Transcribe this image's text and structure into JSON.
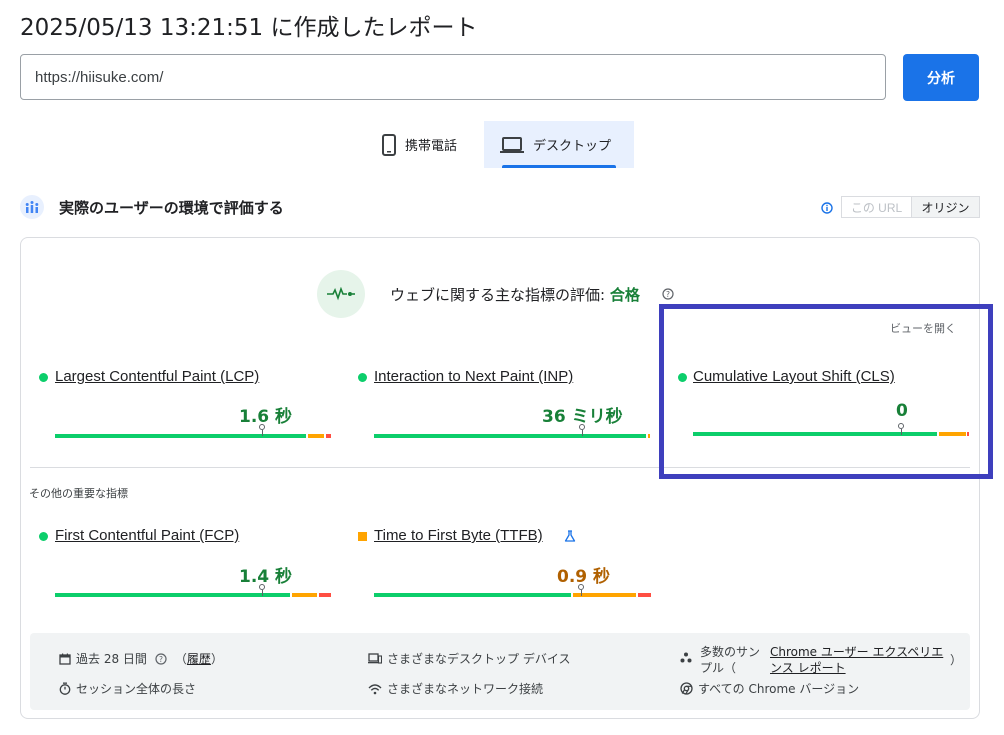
{
  "header": {
    "title": "2025/05/13 13:21:51 に作成したレポート"
  },
  "search": {
    "url_value": "https://hiisuke.com/",
    "analyze_label": "分析"
  },
  "tabs": [
    {
      "label": "携帯電話",
      "icon": "smartphone-icon",
      "selected": false
    },
    {
      "label": "デスクトップ",
      "icon": "laptop-icon",
      "selected": true
    }
  ],
  "field": {
    "title": "実際のユーザーの環境で評価する",
    "toggle_url": "この URL",
    "toggle_origin": "オリジン",
    "cwv_label": "ウェブに関する主な指標の評価:",
    "cwv_status": "合格",
    "expand_label": "ビューを開く",
    "other_label": "その他の重要な指標"
  },
  "metrics": {
    "lcp": {
      "name": "Largest Contentful Paint (LCP)",
      "value": "1.6 秒",
      "status": "good"
    },
    "inp": {
      "name": "Interaction to Next Paint (INP)",
      "value": "36 ミリ秒",
      "status": "good"
    },
    "cls": {
      "name": "Cumulative Layout Shift (CLS)",
      "value": "0",
      "status": "good"
    },
    "fcp": {
      "name": "First Contentful Paint (FCP)",
      "value": "1.4 秒",
      "status": "good"
    },
    "ttfb": {
      "name": "Time to First Byte (TTFB)",
      "value": "0.9 秒",
      "status": "needs-improvement"
    }
  },
  "footer": {
    "period": "過去 28 日間",
    "history_open": "（",
    "history_link": "履歴",
    "history_close": "）",
    "devices": "さまざまなデスクトップ デバイス",
    "samples_prefix_1": "多数のサン",
    "samples_prefix_2": "プル（",
    "crux_link_1": "Chrome ユーザー エクスペリエ",
    "crux_link_2": "ンス レポート",
    "samples_suffix": "）",
    "session": "セッション全体の長さ",
    "network": "さまざまなネットワーク接続",
    "chrome_versions": "すべての Chrome バージョン"
  },
  "colors": {
    "accent": "#1a73e8",
    "good": "#0cce6b",
    "average": "#ffa400",
    "poor": "#ff4e42",
    "highlight": "#3e3fbd"
  }
}
